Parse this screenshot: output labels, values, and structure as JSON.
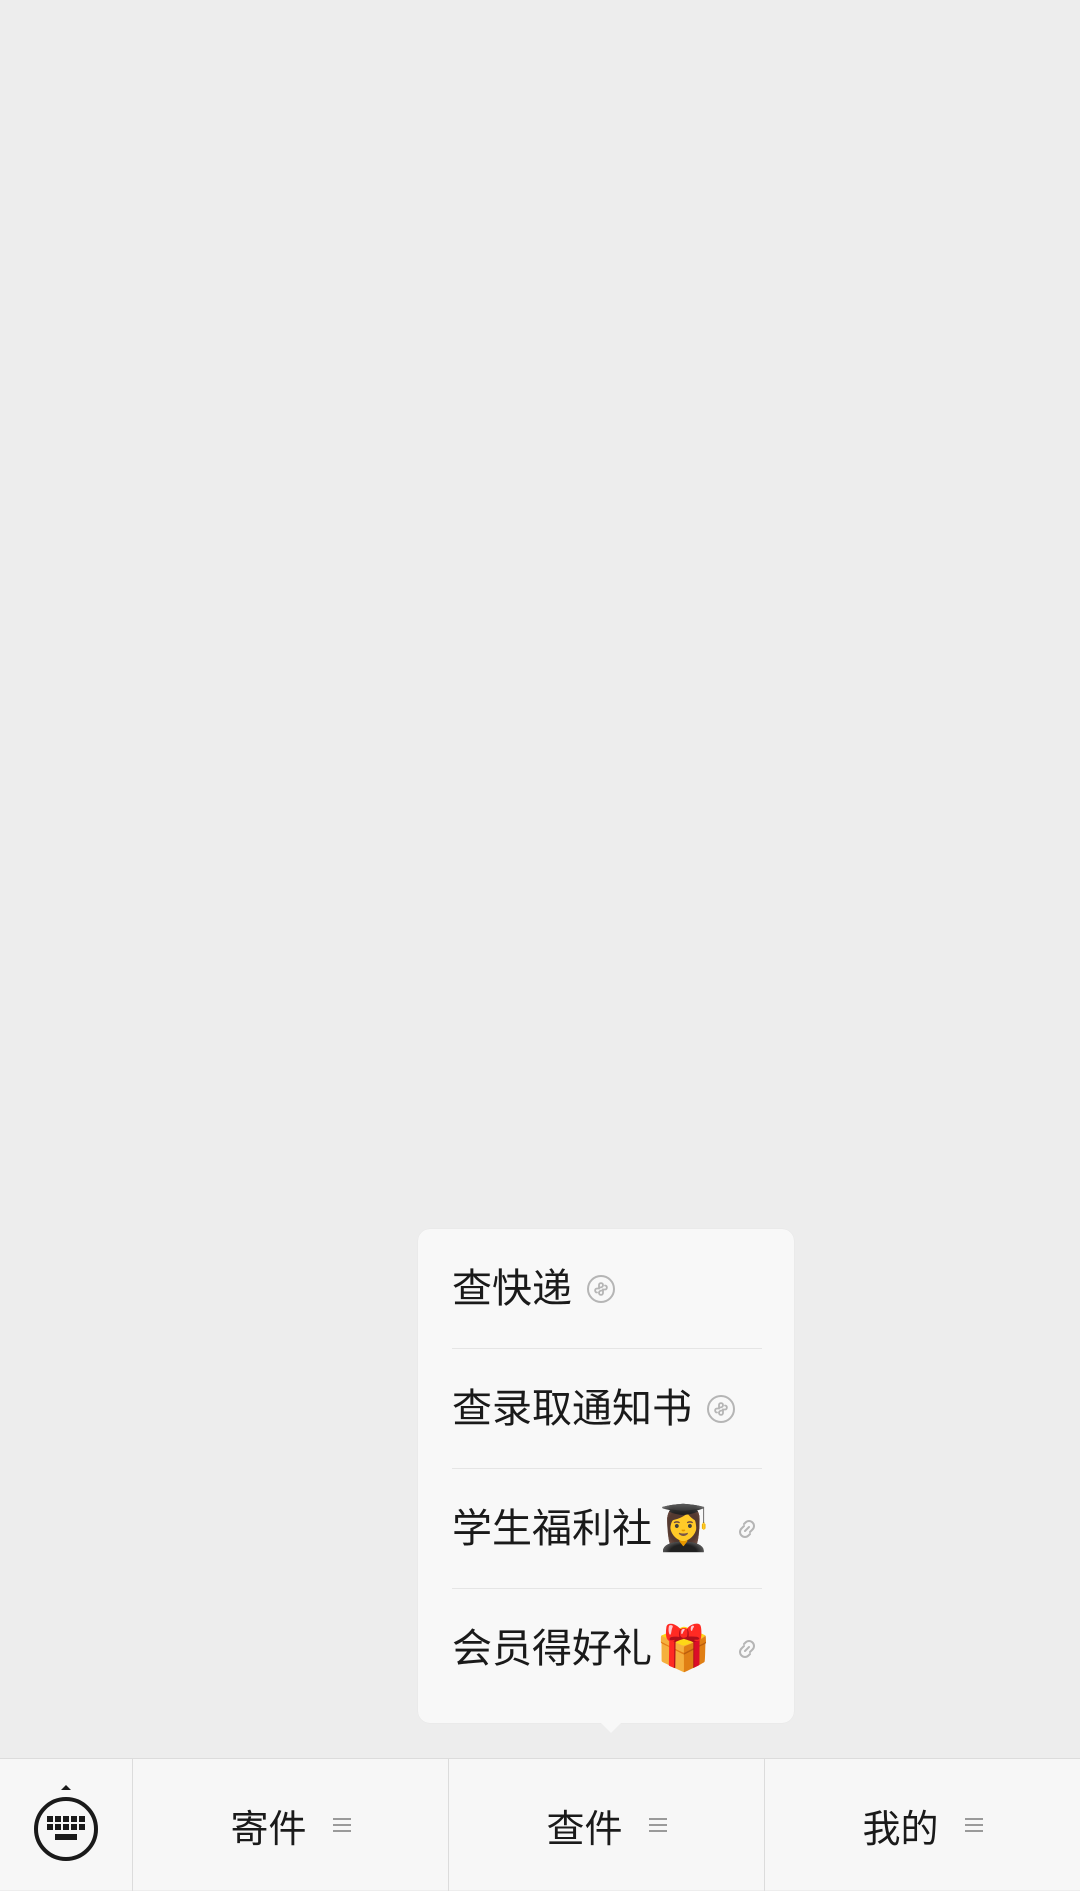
{
  "popup": {
    "items": [
      {
        "label": "查快递",
        "emoji": "",
        "trailing_icon": "mini-program-icon"
      },
      {
        "label": "查录取通知书",
        "emoji": "",
        "trailing_icon": "mini-program-icon"
      },
      {
        "label": "学生福利社",
        "emoji": "👩‍🎓",
        "trailing_icon": "link-icon"
      },
      {
        "label": "会员得好礼",
        "emoji": "🎁",
        "trailing_icon": "link-icon"
      }
    ]
  },
  "menu_bar": {
    "keyboard_icon": "keyboard-icon",
    "tabs": [
      {
        "label": "寄件"
      },
      {
        "label": "查件"
      },
      {
        "label": "我的"
      }
    ]
  }
}
